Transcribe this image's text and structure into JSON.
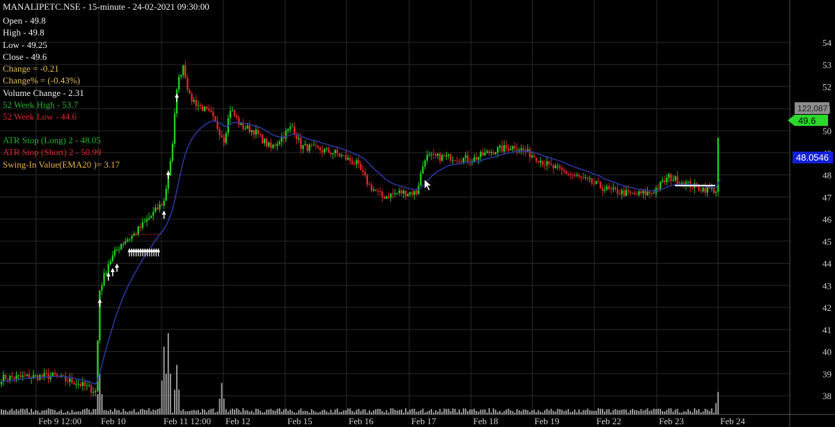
{
  "header": {
    "title": "MANALIPETC.NSE - 15-minute  - 24-02-2021 09:30:00",
    "ohlc": [
      {
        "text": "Open - 49.8",
        "cls": "c-white"
      },
      {
        "text": " High - 49.8",
        "cls": "c-white"
      },
      {
        "text": " Low - 49.25",
        "cls": "c-white"
      },
      {
        "text": " Close - 49.6",
        "cls": "c-white"
      },
      {
        "text": "Change = -0.21",
        "cls": "c-yellow"
      },
      {
        "text": "Change% =  (-0.43%)",
        "cls": "c-yellow"
      },
      {
        "text": "Volume Change - 2.31",
        "cls": "c-white"
      },
      {
        "text": "52 Week High - 53.7",
        "cls": "c-green"
      },
      {
        "text": "52 Week Low - 44.6",
        "cls": "c-red"
      }
    ],
    "indicators": [
      {
        "text": "ATR Stop (Long) 2 - 48.05",
        "cls": "c-green"
      },
      {
        "text": "ATR Stop (Short) 2 - 50.99",
        "cls": "c-red"
      },
      {
        "text": "Swing-In Value(EMA20 )= 3.17",
        "cls": "c-orange"
      }
    ]
  },
  "price_tags": {
    "volume": "122,087",
    "last_price": "49.6",
    "atr_stop": "48.0546"
  },
  "colors": {
    "up": "#1fcf1f",
    "down": "#e0262c",
    "volume": "#9a9a9a",
    "ema": "#2d3aa8",
    "grid": "#2a2a2a",
    "background": "#000000",
    "axis_text": "#cfcfcf",
    "last_price_bg": "#2bd92b",
    "atr_tag_bg": "#1320d8"
  },
  "chart_data": {
    "type": "candlestick",
    "interval": "15-minute",
    "ylim": [
      37.5,
      54.3
    ],
    "y_ticks": [
      38,
      39,
      40,
      41,
      42,
      43,
      44,
      45,
      46,
      47,
      48,
      49,
      50,
      51,
      52,
      53,
      54
    ],
    "x_ticks": [
      "Feb 9  12:00",
      "Feb 10",
      "Feb 11 12:00",
      "Feb 12",
      "Feb 15",
      "Feb 16",
      "Feb 17",
      "Feb 18",
      "Feb 19",
      "Feb 22",
      "Feb 23",
      "Feb 24"
    ],
    "anchors": [
      {
        "i": 0,
        "close": 38.8
      },
      {
        "i": 25,
        "close": 38.9
      },
      {
        "i": 30,
        "close": 38.7
      },
      {
        "i": 35,
        "close": 38.6
      },
      {
        "i": 44,
        "close": 38.2
      },
      {
        "i": 46,
        "close": 42.8
      },
      {
        "i": 50,
        "close": 44.0
      },
      {
        "i": 56,
        "close": 44.9
      },
      {
        "i": 62,
        "close": 45.3
      },
      {
        "i": 76,
        "close": 46.8
      },
      {
        "i": 80,
        "close": 49.3
      },
      {
        "i": 82,
        "close": 52.0
      },
      {
        "i": 85,
        "close": 53.0
      },
      {
        "i": 88,
        "close": 51.5
      },
      {
        "i": 98,
        "close": 50.7
      },
      {
        "i": 104,
        "close": 49.6
      },
      {
        "i": 107,
        "close": 51.0
      },
      {
        "i": 112,
        "close": 50.2
      },
      {
        "i": 118,
        "close": 50.0
      },
      {
        "i": 126,
        "close": 49.2
      },
      {
        "i": 136,
        "close": 50.2
      },
      {
        "i": 140,
        "close": 49.3
      },
      {
        "i": 156,
        "close": 49.0
      },
      {
        "i": 166,
        "close": 48.5
      },
      {
        "i": 172,
        "close": 47.5
      },
      {
        "i": 178,
        "close": 47.0
      },
      {
        "i": 186,
        "close": 47.2
      },
      {
        "i": 194,
        "close": 47.2
      },
      {
        "i": 198,
        "close": 48.8
      },
      {
        "i": 210,
        "close": 48.8
      },
      {
        "i": 220,
        "close": 48.7
      },
      {
        "i": 230,
        "close": 49.1
      },
      {
        "i": 240,
        "close": 49.3
      },
      {
        "i": 250,
        "close": 48.8
      },
      {
        "i": 256,
        "close": 48.4
      },
      {
        "i": 264,
        "close": 48.1
      },
      {
        "i": 272,
        "close": 47.8
      },
      {
        "i": 284,
        "close": 47.3
      },
      {
        "i": 296,
        "close": 47.1
      },
      {
        "i": 304,
        "close": 47.2
      },
      {
        "i": 312,
        "close": 47.9
      },
      {
        "i": 326,
        "close": 47.4
      },
      {
        "i": 334,
        "close": 47.3
      },
      {
        "i": 335,
        "close": 49.6
      }
    ],
    "spikes": [
      {
        "i": 78,
        "v": 0.9
      },
      {
        "i": 76,
        "v": 0.75
      },
      {
        "i": 46,
        "v": 0.45
      },
      {
        "i": 82,
        "v": 0.55
      },
      {
        "i": 103,
        "v": 0.35
      },
      {
        "i": 335,
        "v": 0.25
      }
    ],
    "volume_max": 122087
  }
}
